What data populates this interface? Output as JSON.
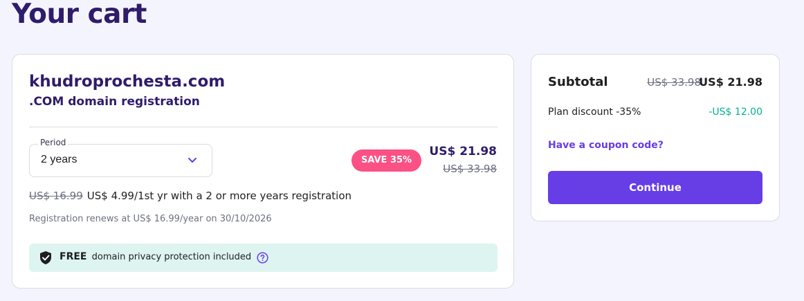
{
  "page": {
    "title": "Your cart"
  },
  "cart_item": {
    "domain_name": "khudroprochesta.com",
    "product_name": ".COM domain registration",
    "period": {
      "label": "Period",
      "selected": "2 years"
    },
    "save_badge": "SAVE 35%",
    "price": "US$ 21.98",
    "old_price": "US$ 33.98",
    "promo": {
      "old_price": "US$ 16.99",
      "text": "US$ 4.99/1st yr with a 2 or more years registration"
    },
    "renewal_text": "Registration renews at US$ 16.99/year on 30/10/2026",
    "privacy": {
      "free_label": "FREE",
      "text": "domain privacy protection included"
    }
  },
  "summary": {
    "subtotal_label": "Subtotal",
    "subtotal_old": "US$ 33.98",
    "subtotal_new": "US$ 21.98",
    "discount_label": "Plan discount -35%",
    "discount_value": "-US$ 12.00",
    "coupon_link": "Have a coupon code?",
    "continue_label": "Continue"
  },
  "colors": {
    "background": "#f4f4ff",
    "brand_purple": "#673de6",
    "heading": "#2f1c6a",
    "save_badge": "#fc5185",
    "discount_green": "#00b090",
    "privacy_bg": "#def4f0"
  },
  "icons": [
    "chevron-down-icon",
    "shield-check-icon",
    "help-circle-icon"
  ]
}
